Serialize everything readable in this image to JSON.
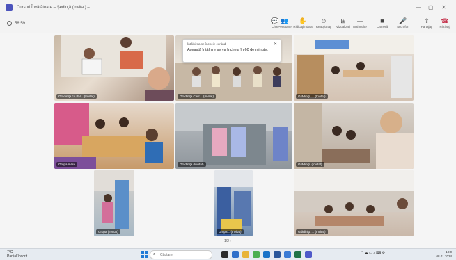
{
  "window": {
    "title": "Cursuri Învățătoare – Şedinţă (Invitat) – ...",
    "minimize": "—",
    "maximize": "▢",
    "close": "✕"
  },
  "meeting": {
    "timer": "58:59",
    "toolbar": [
      {
        "id": "chat",
        "label": "Chat",
        "icon": "chat-icon",
        "glyph": "💬"
      },
      {
        "id": "people",
        "label": "Persoane",
        "icon": "people-icon",
        "glyph": "👥"
      },
      {
        "id": "raise",
        "label": "Ridicaţi mâna",
        "icon": "hand-icon",
        "glyph": "✋"
      },
      {
        "id": "react",
        "label": "Reacţionaţi",
        "icon": "smile-icon",
        "glyph": "☺"
      },
      {
        "id": "view",
        "label": "Vizualizaţi",
        "icon": "grid-icon",
        "glyph": "⊞"
      },
      {
        "id": "more",
        "label": "Mai multe",
        "icon": "more-icon",
        "glyph": "⋯"
      },
      {
        "id": "camera",
        "label": "Cameră",
        "icon": "camera-icon",
        "glyph": "■"
      },
      {
        "id": "mic",
        "label": "Microfon",
        "icon": "mic-icon",
        "glyph": "🎤"
      },
      {
        "id": "share",
        "label": "Partajaţi",
        "icon": "share-icon",
        "glyph": "⇪"
      },
      {
        "id": "leave",
        "label": "Părăsiţi",
        "icon": "phone-icon",
        "glyph": "☎"
      }
    ]
  },
  "participants": [
    {
      "name": "Grădiniţa cu PN... (Invitat)"
    },
    {
      "name": "Grădiniţa Cerc... (Invitat)"
    },
    {
      "name": "Grădiniţa ... (Invitat)"
    },
    {
      "name": "Grupa mare"
    },
    {
      "name": "Grădiniţa (Invitat)"
    },
    {
      "name": "Grădiniţa (Invitat)"
    },
    {
      "name": "Grupa (Invitat)"
    },
    {
      "name": "Grupa... (Invitat)"
    },
    {
      "name": "Grădiniţa ... (Invitat)"
    }
  ],
  "notice": {
    "heading": "Întâlnirea se încheie curând",
    "text": "Această întâlnire se va încheia în 60 de minute.",
    "close": "✕"
  },
  "pager": {
    "text": "1/2  ›"
  },
  "taskbar": {
    "weather_temp": "7°C",
    "weather_desc": "Parţial însorit",
    "search_placeholder": "Căutare",
    "time": "19:0",
    "date": "08.01.2024"
  }
}
